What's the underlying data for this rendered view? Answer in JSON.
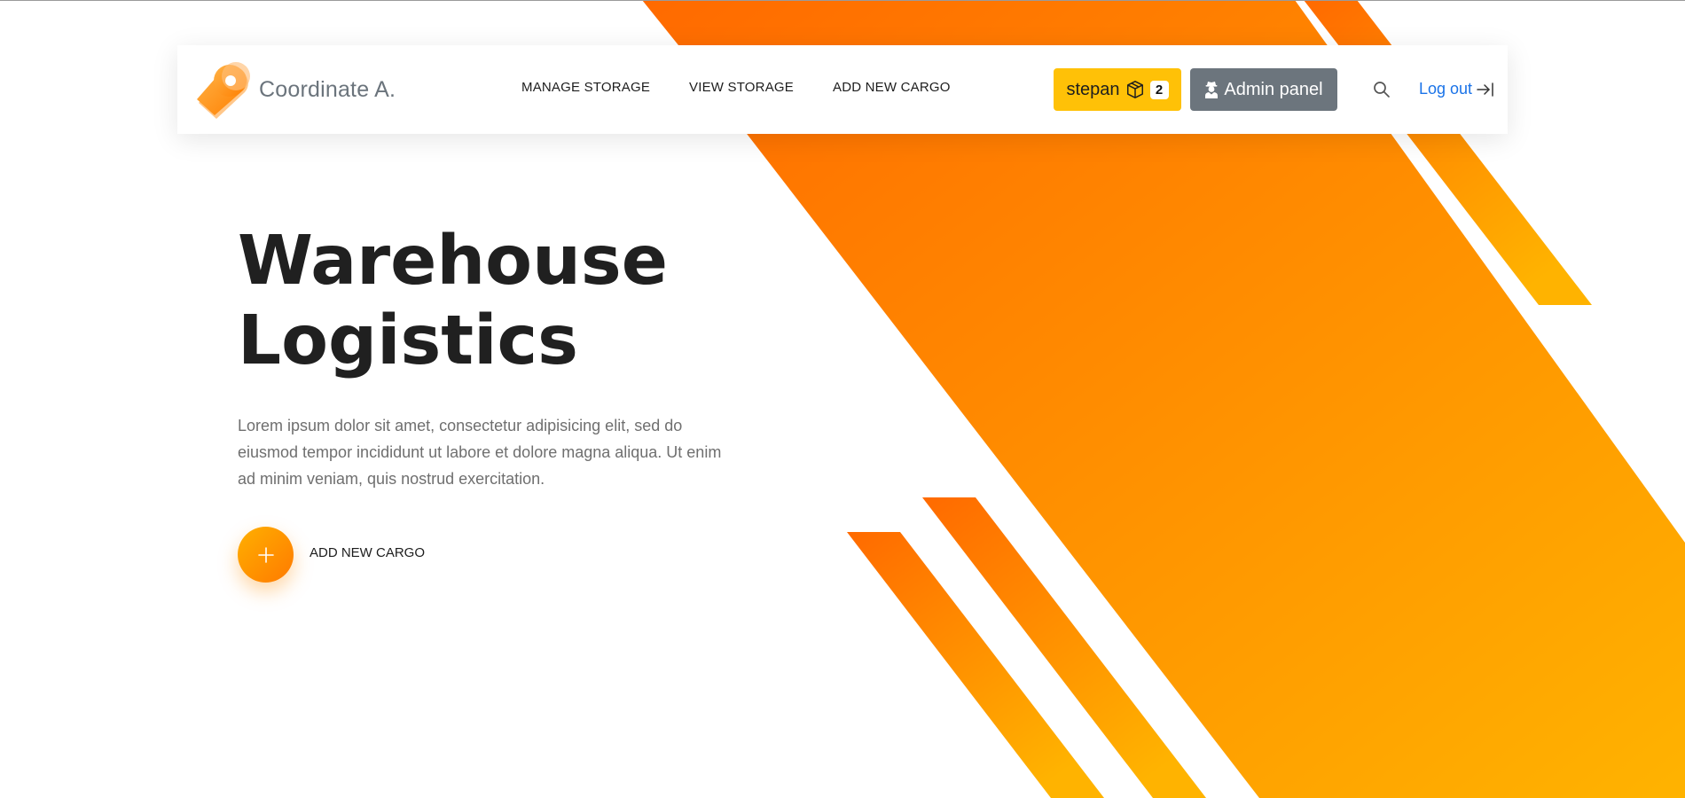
{
  "brand": {
    "name": "Coordinate A.",
    "logo_icon": "map-pin-icon"
  },
  "nav": {
    "items": [
      {
        "label": "MANAGE STORAGE"
      },
      {
        "label": "VIEW STORAGE"
      },
      {
        "label": "ADD NEW CARGO"
      }
    ]
  },
  "user": {
    "name": "stepan",
    "icon": "box-icon",
    "cargo_count": "2"
  },
  "admin": {
    "label": "Admin panel",
    "icon": "user-secret-icon"
  },
  "search": {
    "icon": "search-icon"
  },
  "logout": {
    "label": "Log out",
    "icon": "logout-arrow-icon"
  },
  "hero": {
    "title_line1": "Warehouse",
    "title_line2": "Logistics",
    "text": "Lorem ipsum dolor sit amet, consectetur adipisicing elit, sed do eiusmod tempor incididunt ut labore et dolore magna aliqua. Ut enim ad minim veniam, quis nostrud exercitation.",
    "cta_label": "ADD NEW CARGO",
    "cta_icon": "plus-icon"
  },
  "colors": {
    "accent_orange": "#ff6a00",
    "accent_yellow": "#ffb300",
    "user_button": "#ffc107",
    "admin_button": "#6c757d",
    "link": "#1a73e8",
    "title": "#202020"
  }
}
